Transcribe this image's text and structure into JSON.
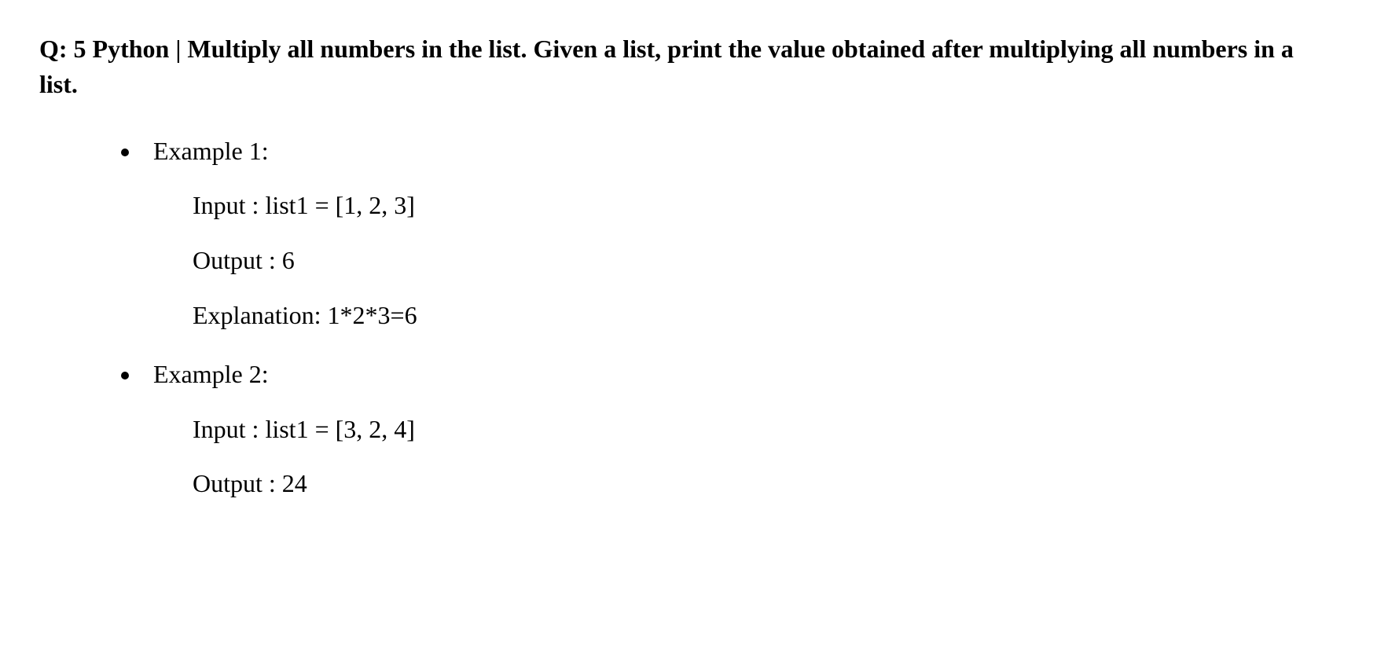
{
  "title": "Q: 5 Python | Multiply all numbers in the list. Given a list, print the value obtained after multiplying all numbers in a list.",
  "examples": [
    {
      "label": "Example 1:",
      "input": "Input :  list1 = [1, 2, 3]",
      "output": "Output : 6",
      "explanation": "Explanation: 1*2*3=6"
    },
    {
      "label": "Example 2:",
      "input": "Input : list1 = [3, 2, 4]",
      "output": "Output : 24",
      "explanation": null
    }
  ]
}
